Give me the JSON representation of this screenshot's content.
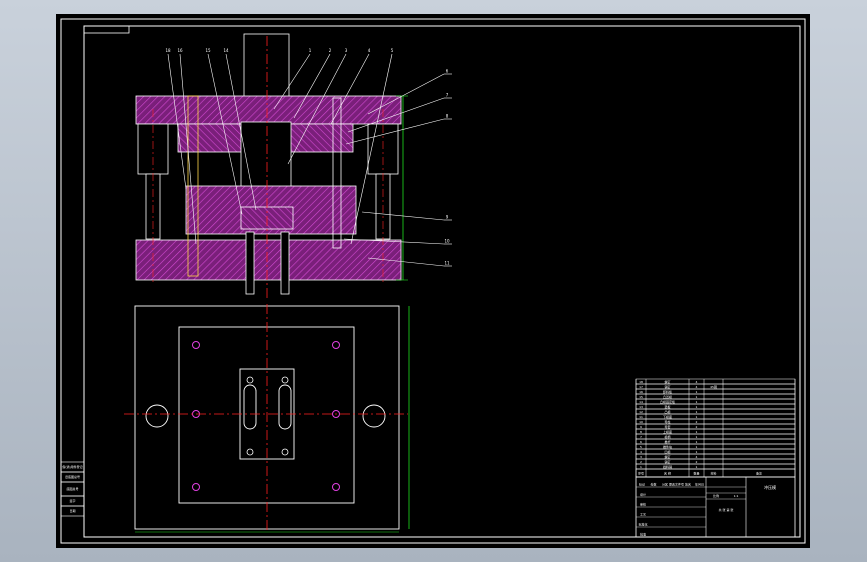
{
  "colors": {
    "background": "#000000",
    "frame": "#ffffff",
    "hatch_fill": "#7a1f7a",
    "hatch_line": "#d24ad2",
    "center_line": "#ff2020",
    "leader": "#ffffff",
    "dimension": "#20e020",
    "hole_mark": "#e040e0"
  },
  "callouts_top": [
    "18",
    "16",
    "15",
    "14",
    "1",
    "2",
    "3",
    "4",
    "5"
  ],
  "callouts_right": [
    "6",
    "7",
    "8",
    "9",
    "10",
    "11"
  ],
  "bom": {
    "rows": [
      {
        "no": "18",
        "name": "螺钉",
        "qty": "4",
        "material": "",
        "note": ""
      },
      {
        "no": "17",
        "name": "销钉",
        "qty": "4",
        "material": "45钢",
        "note": ""
      },
      {
        "no": "16",
        "name": "卸料板",
        "qty": "1",
        "material": "",
        "note": ""
      },
      {
        "no": "15",
        "name": "凸凹模",
        "qty": "1",
        "material": "",
        "note": ""
      },
      {
        "no": "14",
        "name": "凸模固定板",
        "qty": "1",
        "material": "",
        "note": ""
      },
      {
        "no": "13",
        "name": "垫板",
        "qty": "1",
        "material": "",
        "note": ""
      },
      {
        "no": "12",
        "name": "凸模",
        "qty": "1",
        "material": "",
        "note": ""
      },
      {
        "no": "11",
        "name": "下模座",
        "qty": "1",
        "material": "",
        "note": ""
      },
      {
        "no": "10",
        "name": "导柱",
        "qty": "2",
        "material": "",
        "note": ""
      },
      {
        "no": "9",
        "name": "导套",
        "qty": "2",
        "material": "",
        "note": ""
      },
      {
        "no": "8",
        "name": "上模座",
        "qty": "1",
        "material": "",
        "note": ""
      },
      {
        "no": "7",
        "name": "模柄",
        "qty": "1",
        "material": "",
        "note": ""
      },
      {
        "no": "6",
        "name": "推杆",
        "qty": "1",
        "material": "",
        "note": ""
      },
      {
        "no": "5",
        "name": "推件块",
        "qty": "1",
        "material": "",
        "note": ""
      },
      {
        "no": "4",
        "name": "凹模",
        "qty": "1",
        "material": "",
        "note": ""
      },
      {
        "no": "3",
        "name": "螺钉",
        "qty": "4",
        "material": "",
        "note": ""
      },
      {
        "no": "2",
        "name": "销钉",
        "qty": "2",
        "material": "",
        "note": ""
      },
      {
        "no": "1",
        "name": "挡料销",
        "qty": "1",
        "material": "",
        "note": ""
      }
    ],
    "header": {
      "no": "序号",
      "name": "名 称",
      "qty": "数量",
      "material": "材料",
      "note": "备注"
    }
  },
  "title_block": {
    "drawing_name": "冲压模",
    "labels": [
      "标记",
      "处数",
      "分区",
      "更改文件号",
      "签名",
      "年月日",
      "设计",
      "审核",
      "工艺",
      "标准化",
      "批准"
    ],
    "scale_label": "比例",
    "scale": "1:1",
    "sheet": "共 张 第 张"
  },
  "left_stamp": {
    "lines": [
      "借(通)用件登记",
      "旧底图总号",
      "底图总号",
      "签字",
      "日期"
    ]
  }
}
